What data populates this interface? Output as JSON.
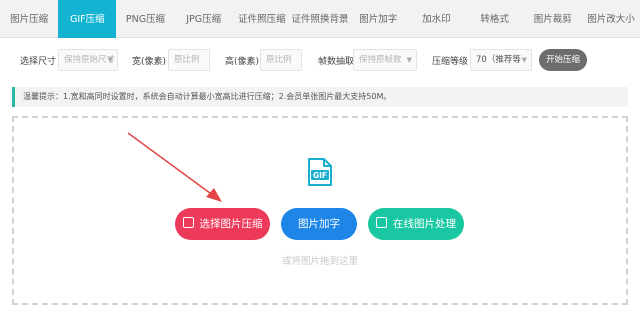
{
  "tabs": [
    {
      "label": "图片压缩",
      "active": false
    },
    {
      "label": "GIF压缩",
      "active": true
    },
    {
      "label": "PNG压缩",
      "active": false
    },
    {
      "label": "JPG压缩",
      "active": false
    },
    {
      "label": "证件照压缩",
      "active": false
    },
    {
      "label": "证件照换背景",
      "active": false
    },
    {
      "label": "图片加字",
      "active": false
    },
    {
      "label": "加水印",
      "active": false
    },
    {
      "label": "转格式",
      "active": false
    },
    {
      "label": "图片裁剪",
      "active": false
    },
    {
      "label": "图片改大小",
      "active": false
    }
  ],
  "options": {
    "size_label": "选择尺寸",
    "size_value": "保持原始尺寸",
    "width_label": "宽(像素)",
    "width_placeholder": "原比例",
    "height_label": "高(像素)",
    "height_placeholder": "原比例",
    "fps_label": "帧数抽取",
    "fps_value": "保持原帧数",
    "level_label": "压缩等级",
    "level_value": "70（推荐等",
    "start_label": "开始压缩"
  },
  "tip": "温馨提示：1.宽和高同时设置时，系统会自动计算最小宽高比进行压缩；2.会员单张图片最大支持50M。",
  "dropzone": {
    "gif_badge": "GIF",
    "select_button": "选择图片压缩",
    "add_text_button": "图片加字",
    "online_button": "在线图片处理",
    "drag_hint": "或将图片拖到这里"
  },
  "colors": {
    "accent": "#14b3d2",
    "select_button": "#ee3a5a",
    "add_text_button": "#1d86e6",
    "online_button": "#19c8a2",
    "arrow": "#e24646"
  }
}
